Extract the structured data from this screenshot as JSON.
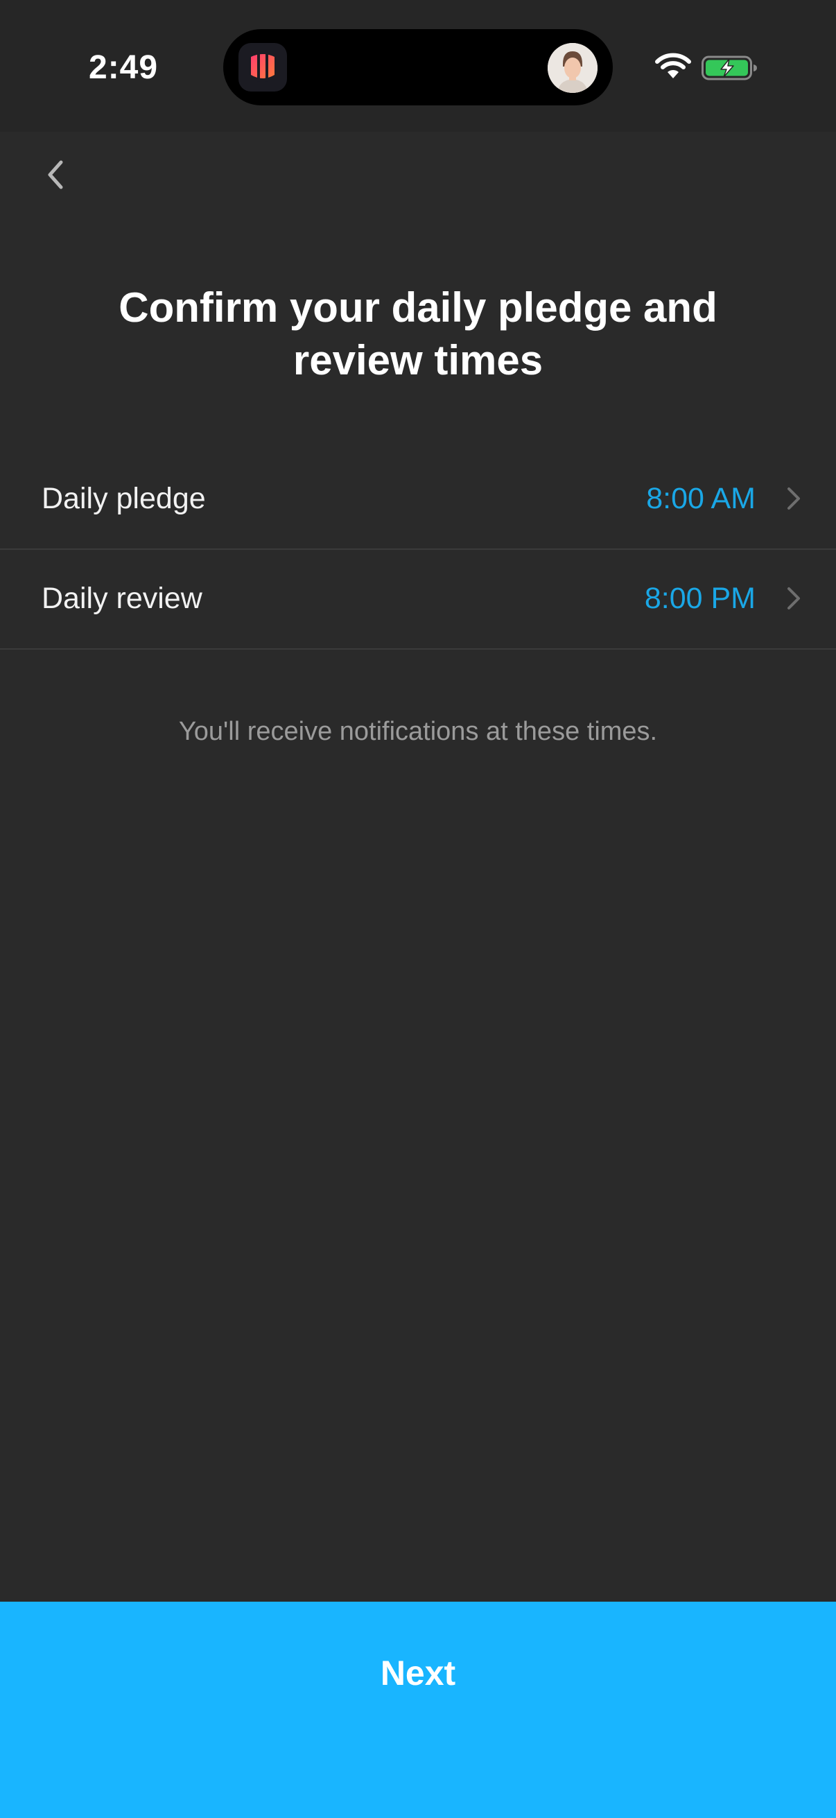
{
  "status_bar": {
    "time": "2:49",
    "icons": [
      "app-icon",
      "avatar-icon",
      "wifi-icon",
      "battery-charging-icon"
    ],
    "battery_color": "#34c759"
  },
  "nav": {
    "back_icon": "chevron-left-icon"
  },
  "title": {
    "line1": "Confirm your daily pledge and",
    "line2": "review times"
  },
  "settings": {
    "rows": [
      {
        "label": "Daily pledge",
        "value": "8:00 AM"
      },
      {
        "label": "Daily review",
        "value": "8:00 PM"
      }
    ],
    "value_color": "#1aa7e6"
  },
  "note": "You'll receive notifications at these times.",
  "primary_button": {
    "label": "Next",
    "color": "#19b5ff"
  }
}
